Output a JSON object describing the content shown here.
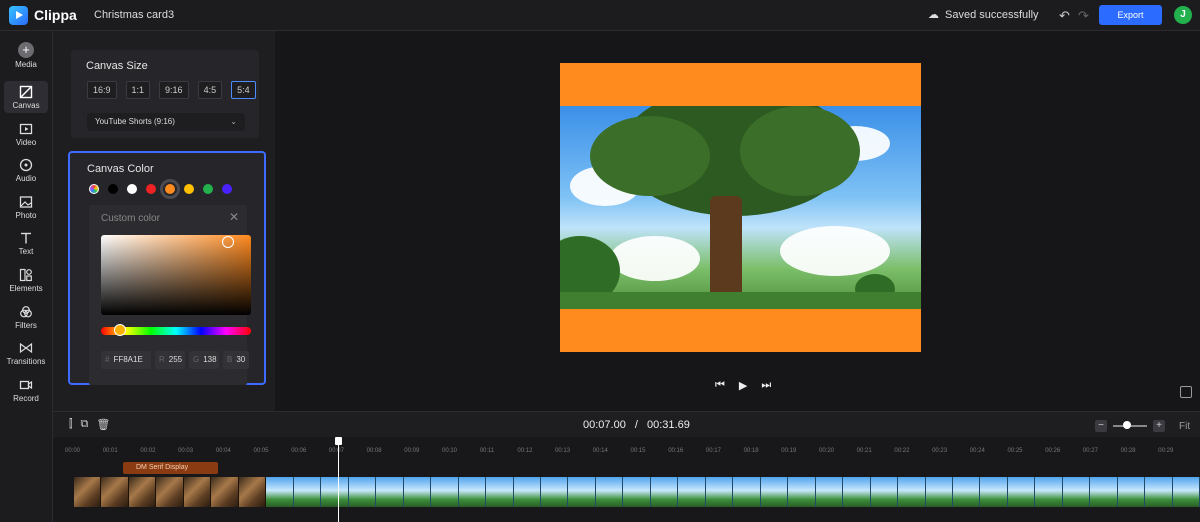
{
  "app": {
    "name": "Clippa",
    "project_title": "Christmas card3"
  },
  "header": {
    "save_status": "Saved successfully",
    "export_label": "Export",
    "user_initial": "J"
  },
  "sidebar": {
    "items": [
      {
        "label": "Media",
        "icon": "plus-circle-icon"
      },
      {
        "label": "Canvas",
        "icon": "canvas-icon",
        "active": true
      },
      {
        "label": "Video",
        "icon": "video-icon"
      },
      {
        "label": "Audio",
        "icon": "audio-icon"
      },
      {
        "label": "Photo",
        "icon": "photo-icon"
      },
      {
        "label": "Text",
        "icon": "text-icon"
      },
      {
        "label": "Elements",
        "icon": "elements-icon"
      },
      {
        "label": "Filters",
        "icon": "filters-icon"
      },
      {
        "label": "Transitions",
        "icon": "transitions-icon"
      },
      {
        "label": "Record",
        "icon": "record-icon"
      }
    ]
  },
  "canvas_size": {
    "title": "Canvas Size",
    "ratios": [
      "16:9",
      "1:1",
      "9:16",
      "4:5",
      "5:4"
    ],
    "selected_ratio": "5:4",
    "preset": "YouTube Shorts (9:16)"
  },
  "canvas_color": {
    "title": "Canvas Color",
    "swatches": [
      "multicolor",
      "#000000",
      "#ffffff",
      "#ee2222",
      "#ff8a1e",
      "#ffc000",
      "#22b14c",
      "#4a22ff"
    ],
    "selected_swatch": "#ff8a1e",
    "picker": {
      "title": "Custom color",
      "hex_label": "#",
      "hex": "FF8A1E",
      "r_label": "R",
      "r": "255",
      "g_label": "G",
      "g": "138",
      "b_label": "B",
      "b": "30"
    }
  },
  "preview": {
    "frame_color": "#ff8a1e"
  },
  "timeline": {
    "current_time": "00:07.00",
    "separator": "/",
    "total_time": "00:31.69",
    "fit_label": "Fit",
    "text_clip_label": "DM Serif Display",
    "ruler_labels": [
      "00:00",
      "00:01",
      "00:02",
      "00:03",
      "00:04",
      "00:05",
      "00:06",
      "00:07",
      "00:08",
      "00:09",
      "00:10",
      "00:11",
      "00:12",
      "00:13",
      "00:14",
      "00:15",
      "00:16",
      "00:17",
      "00:18",
      "00:19",
      "00:20",
      "00:21",
      "00:22",
      "00:23",
      "00:24",
      "00:25",
      "00:26",
      "00:27",
      "00:28",
      "00:29"
    ]
  },
  "colors": {
    "accent": "#2b6bff",
    "selection_border": "#3d6bff",
    "avatar": "#22b14c"
  }
}
